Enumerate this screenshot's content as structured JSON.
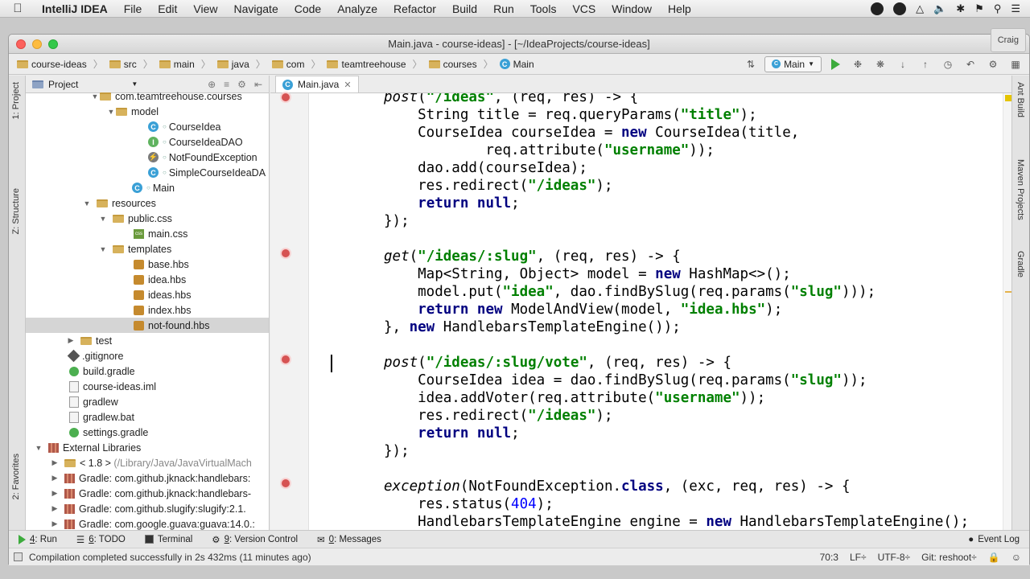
{
  "menubar": {
    "app_name": "IntelliJ IDEA",
    "items": [
      "File",
      "Edit",
      "View",
      "Navigate",
      "Code",
      "Analyze",
      "Refactor",
      "Build",
      "Run",
      "Tools",
      "VCS",
      "Window",
      "Help"
    ]
  },
  "window": {
    "title": "Main.java - course-ideas] - [~/IdeaProjects/course-ideas]",
    "user": "Craig"
  },
  "breadcrumbs": [
    "course-ideas",
    "src",
    "main",
    "java",
    "com",
    "teamtreehouse",
    "courses",
    "Main"
  ],
  "run_config": "Main",
  "project_panel": {
    "label": "Project",
    "rows": [
      {
        "text": "com.teamtreehouse.courses"
      },
      {
        "text": "model"
      },
      {
        "text": "CourseIdea"
      },
      {
        "text": "CourseIdeaDAO"
      },
      {
        "text": "NotFoundException"
      },
      {
        "text": "SimpleCourseIdeaDA"
      },
      {
        "text": "Main"
      },
      {
        "text": "resources"
      },
      {
        "text": "public.css"
      },
      {
        "text": "main.css"
      },
      {
        "text": "templates"
      },
      {
        "text": "base.hbs"
      },
      {
        "text": "idea.hbs"
      },
      {
        "text": "ideas.hbs"
      },
      {
        "text": "index.hbs"
      },
      {
        "text": "not-found.hbs"
      },
      {
        "text": "test"
      },
      {
        "text": ".gitignore"
      },
      {
        "text": "build.gradle"
      },
      {
        "text": "course-ideas.iml"
      },
      {
        "text": "gradlew"
      },
      {
        "text": "gradlew.bat"
      },
      {
        "text": "settings.gradle"
      },
      {
        "text": "External Libraries"
      },
      {
        "text": "< 1.8 >",
        "suffix": "(/Library/Java/JavaVirtualMach"
      },
      {
        "text": "Gradle: com.github.jknack:handlebars:"
      },
      {
        "text": "Gradle: com.github.jknack:handlebars-"
      },
      {
        "text": "Gradle: com.github.slugify:slugify:2.1."
      },
      {
        "text": "Gradle: com.google.guava:guava:14.0.:"
      }
    ]
  },
  "left_tabs": {
    "project": "1: Project",
    "structure": "Z: Structure",
    "favorites": "2: Favorites"
  },
  "right_tabs": {
    "ant": "Ant Build",
    "maven": "Maven Projects",
    "gradle": "Gradle"
  },
  "editor": {
    "tab_label": "Main.java",
    "code_lines": [
      "post(\"/ideas\", (req, res) -> {",
      "    String title = req.queryParams(\"title\");",
      "    CourseIdea courseIdea = new CourseIdea(title,",
      "            req.attribute(\"username\"));",
      "    dao.add(courseIdea);",
      "    res.redirect(\"/ideas\");",
      "    return null;",
      "});",
      "",
      "get(\"/ideas/:slug\", (req, res) -> {",
      "    Map<String, Object> model = new HashMap<>();",
      "    model.put(\"idea\", dao.findBySlug(req.params(\"slug\")));",
      "    return new ModelAndView(model, \"idea.hbs\");",
      "}, new HandlebarsTemplateEngine());",
      "",
      "post(\"/ideas/:slug/vote\", (req, res) -> {",
      "    CourseIdea idea = dao.findBySlug(req.params(\"slug\"));",
      "    idea.addVoter(req.attribute(\"username\"));",
      "    res.redirect(\"/ideas\");",
      "    return null;",
      "});",
      "",
      "exception(NotFoundException.class, (exc, req, res) -> {",
      "    res.status(404);",
      "    HandlebarsTemplateEngine engine = new HandlebarsTemplateEngine();"
    ]
  },
  "bottom_tools": [
    {
      "key": "4",
      "label": ": Run"
    },
    {
      "key": "6",
      "label": ": TODO"
    },
    {
      "key": "",
      "label": "Terminal"
    },
    {
      "key": "9",
      "label": ": Version Control"
    },
    {
      "key": "0",
      "label": ": Messages"
    }
  ],
  "event_log": "Event Log",
  "status": {
    "message": "Compilation completed successfully in 2s 432ms (11 minutes ago)",
    "position": "70:3",
    "line_sep": "LF÷",
    "encoding": "UTF-8÷",
    "git": "Git: reshoot÷"
  },
  "colors": {
    "keyword": "#000080",
    "string": "#008000",
    "number": "#0000ff",
    "breakpoint": "#d65353"
  }
}
